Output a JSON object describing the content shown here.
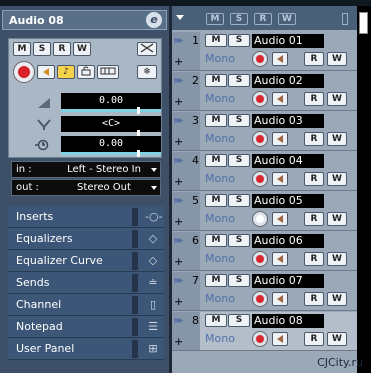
{
  "inspector": {
    "title": "Audio 08",
    "edit_label": "e",
    "buttons": {
      "mute": "M",
      "solo": "S",
      "read": "R",
      "write": "W"
    },
    "volume_value": "0.00",
    "pan_value": "<C>",
    "delay_value": "0.00",
    "input": {
      "label": "in :",
      "value": "Left - Stereo In"
    },
    "output": {
      "label": "out :",
      "value": "Stereo Out"
    },
    "sections": [
      {
        "label": "Inserts",
        "icon": "inserts-icon"
      },
      {
        "label": "Equalizers",
        "icon": "equalizer-icon"
      },
      {
        "label": "Equalizer Curve",
        "icon": "eq-curve-icon"
      },
      {
        "label": "Sends",
        "icon": "sends-icon"
      },
      {
        "label": "Channel",
        "icon": "channel-icon"
      },
      {
        "label": "Notepad",
        "icon": "notepad-icon"
      },
      {
        "label": "User Panel",
        "icon": "user-panel-icon"
      }
    ]
  },
  "tracklist_header": {
    "buttons": [
      "M",
      "S",
      "R",
      "W"
    ]
  },
  "tracks": [
    {
      "number": "1",
      "name": "Audio 01",
      "mode": "Mono",
      "record_enabled": true
    },
    {
      "number": "2",
      "name": "Audio 02",
      "mode": "Mono",
      "record_enabled": true
    },
    {
      "number": "3",
      "name": "Audio 03",
      "mode": "Mono",
      "record_enabled": true
    },
    {
      "number": "4",
      "name": "Audio 04",
      "mode": "Mono",
      "record_enabled": true
    },
    {
      "number": "5",
      "name": "Audio 05",
      "mode": "Mono",
      "record_enabled": false
    },
    {
      "number": "6",
      "name": "Audio 06",
      "mode": "Mono",
      "record_enabled": true
    },
    {
      "number": "7",
      "name": "Audio 07",
      "mode": "Mono",
      "record_enabled": true
    },
    {
      "number": "8",
      "name": "Audio 08",
      "mode": "Mono",
      "record_enabled": true,
      "selected": true
    }
  ],
  "track_buttons": {
    "mute": "M",
    "solo": "S",
    "read": "R",
    "write": "W"
  },
  "watermark": "CJCity.ru",
  "colors": {
    "record": "#d82830",
    "selection": "#ffffff",
    "accent": "#7fd0e0"
  }
}
